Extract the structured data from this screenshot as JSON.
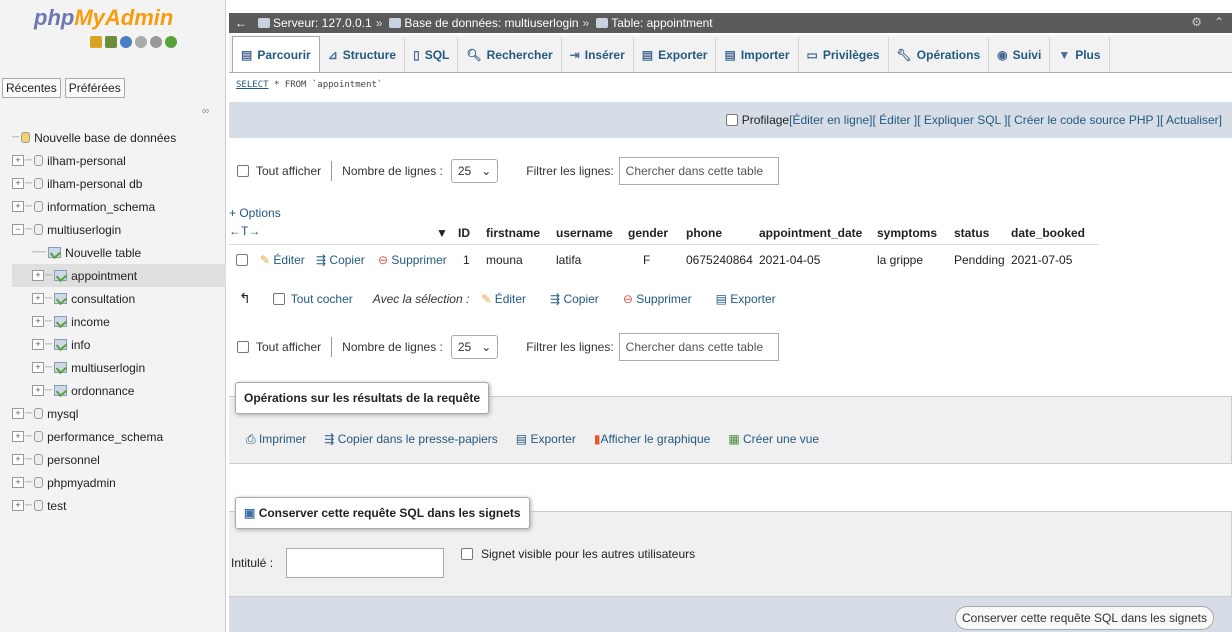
{
  "logo": {
    "part1": "php",
    "part2": "MyAdmin"
  },
  "sidebar": {
    "tabs": [
      "Récentes",
      "Préférées"
    ],
    "items": [
      {
        "label": "Nouvelle base de données"
      },
      {
        "label": "ilham-personal"
      },
      {
        "label": "ilham-personal db"
      },
      {
        "label": "information_schema"
      },
      {
        "label": "multiuserlogin"
      },
      {
        "label": "Nouvelle table"
      },
      {
        "label": "appointment"
      },
      {
        "label": "consultation"
      },
      {
        "label": "income"
      },
      {
        "label": "info"
      },
      {
        "label": "multiuserlogin"
      },
      {
        "label": "ordonnance"
      },
      {
        "label": "mysql"
      },
      {
        "label": "performance_schema"
      },
      {
        "label": "personnel"
      },
      {
        "label": "phpmyadmin"
      },
      {
        "label": "test"
      }
    ]
  },
  "breadcrumb": {
    "server": "Serveur: 127.0.0.1",
    "sep1": "»",
    "database": "Base de données: multiuserlogin",
    "sep2": "»",
    "table": "Table: appointment"
  },
  "tabs": [
    {
      "label": "Parcourir"
    },
    {
      "label": "Structure"
    },
    {
      "label": "SQL"
    },
    {
      "label": "Rechercher"
    },
    {
      "label": "Insérer"
    },
    {
      "label": "Exporter"
    },
    {
      "label": "Importer"
    },
    {
      "label": "Privilèges"
    },
    {
      "label": "Opérations"
    },
    {
      "label": "Suivi"
    },
    {
      "label": "Plus"
    }
  ],
  "sql": {
    "keyword": "SELECT",
    "rest": "* FROM `appointment`"
  },
  "profiling": {
    "label": "Profilage",
    "links": [
      "[Éditer en ligne]",
      "[ Éditer ]",
      "[ Expliquer SQL ]",
      "[ Créer le code source PHP ]",
      "[ Actualiser]"
    ]
  },
  "nav": {
    "show_all": "Tout afficher",
    "rows_label": "Nombre de lignes :",
    "rows_value": "25",
    "filter_label": "Filtrer les lignes:",
    "filter_placeholder": "Chercher dans cette table"
  },
  "options_link": "+ Options",
  "table": {
    "headers": [
      "ID",
      "firstname",
      "username",
      "gender",
      "phone",
      "appointment_date",
      "symptoms",
      "status",
      "date_booked"
    ],
    "row_actions": [
      "Éditer",
      "Copier",
      "Supprimer"
    ],
    "rows": [
      [
        "1",
        "mouna",
        "latifa",
        "F",
        "0675240864",
        "2021-04-05",
        "la grippe",
        "Pendding",
        "2021-07-05"
      ]
    ]
  },
  "with_selection": {
    "check_all": "Tout cocher",
    "label": "Avec la sélection :",
    "actions": [
      "Éditer",
      "Copier",
      "Supprimer",
      "Exporter"
    ]
  },
  "ops": {
    "legend": "Opérations sur les résultats de la requête",
    "links": [
      "Imprimer",
      "Copier dans le presse-papiers",
      "Exporter",
      "Afficher le graphique",
      "Créer une vue"
    ]
  },
  "bookmark": {
    "legend": "Conserver cette requête SQL dans les signets",
    "title_label": "Intitulé :",
    "visible_label": "Signet visible pour les autres utilisateurs",
    "button": "Conserver cette requête SQL dans les signets"
  },
  "colors": {
    "link": "#235a81",
    "topbar": "#5a5a5a",
    "profbar": "#d6dde6"
  }
}
